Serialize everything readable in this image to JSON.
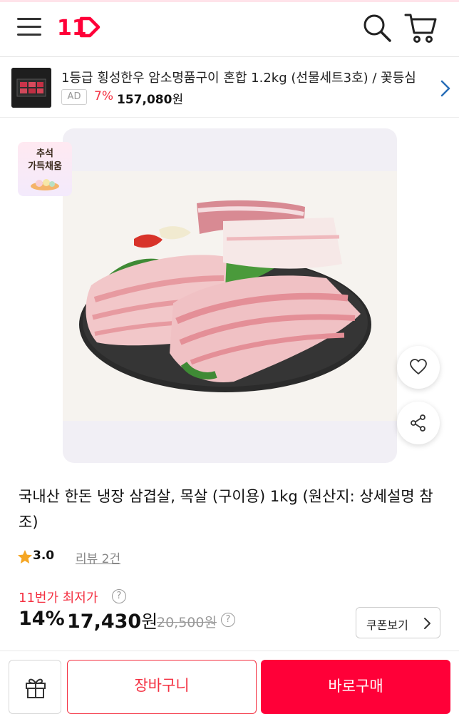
{
  "header": {
    "logo_text": "11",
    "brand_color": "#ff0038"
  },
  "ad": {
    "title": "1등급 횡성한우 암소명품구이 혼합 1.2kg (선물세트3호) / 꽃등심",
    "badge": "AD",
    "discount": "7%",
    "price": "157,080",
    "currency": "원"
  },
  "event_badge": {
    "line1": "추석",
    "line2": "가득채움"
  },
  "product": {
    "title": "국내산 한돈 냉장 삼겹살, 목살 (구이용) 1kg (원산지: 상세설명 참조)",
    "rating": "3.0",
    "review_label": "리뷰 2건"
  },
  "price": {
    "lowest_label": "11번가 최저가",
    "discount": "14%",
    "sale_price": "17,430",
    "currency": "원",
    "original_price": "20,500원",
    "help_glyph": "?",
    "coupon_label": "쿠폰보기"
  },
  "bottom": {
    "cart_label": "장바구니",
    "buy_label": "바로구매"
  },
  "colors": {
    "accent": "#f43142",
    "buy": "#ff0038",
    "star": "#f5a623"
  },
  "icons": [
    "menu-icon",
    "logo",
    "search-icon",
    "cart-icon",
    "chevron-right-icon",
    "heart-icon",
    "share-icon",
    "star-icon",
    "help-icon",
    "gift-icon"
  ]
}
